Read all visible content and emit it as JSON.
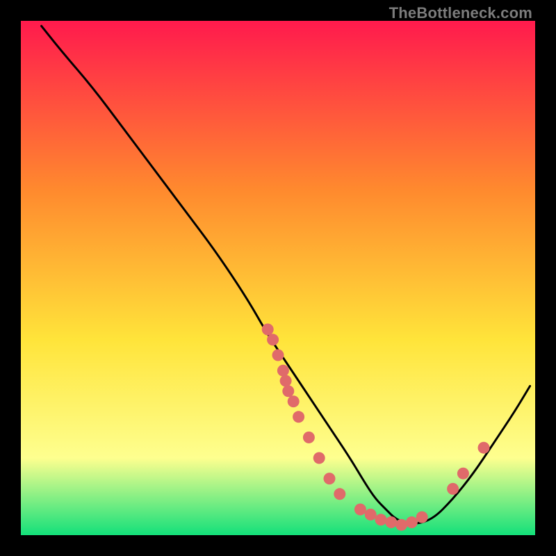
{
  "watermark": "TheBottleneck.com",
  "colors": {
    "gradient_top": "#ff1a4d",
    "gradient_mid1": "#ff8a2e",
    "gradient_mid2": "#ffe43a",
    "gradient_mid3": "#feff8f",
    "gradient_bottom": "#13e07a",
    "curve": "#000000",
    "dots": "#e06a6a",
    "frame_bg": "#000000"
  },
  "chart_data": {
    "type": "line",
    "title": "",
    "xlabel": "",
    "ylabel": "",
    "xlim": [
      0,
      100
    ],
    "ylim": [
      0,
      100
    ],
    "series": [
      {
        "name": "bottleneck-curve",
        "x": [
          4,
          8,
          14,
          20,
          26,
          32,
          38,
          44,
          48,
          52,
          56,
          60,
          64,
          67,
          69,
          71,
          73,
          76,
          80,
          84,
          88,
          92,
          96,
          99
        ],
        "y": [
          99,
          94,
          87,
          79,
          71,
          63,
          55,
          46,
          39,
          33,
          27,
          21,
          15,
          10,
          7,
          5,
          3,
          2,
          3,
          7,
          12,
          18,
          24,
          29
        ]
      }
    ],
    "scatter": {
      "name": "data-points",
      "points": [
        {
          "x": 48,
          "y": 40
        },
        {
          "x": 49,
          "y": 38
        },
        {
          "x": 50,
          "y": 35
        },
        {
          "x": 51,
          "y": 32
        },
        {
          "x": 51.5,
          "y": 30
        },
        {
          "x": 52,
          "y": 28
        },
        {
          "x": 53,
          "y": 26
        },
        {
          "x": 54,
          "y": 23
        },
        {
          "x": 56,
          "y": 19
        },
        {
          "x": 58,
          "y": 15
        },
        {
          "x": 60,
          "y": 11
        },
        {
          "x": 62,
          "y": 8
        },
        {
          "x": 66,
          "y": 5
        },
        {
          "x": 68,
          "y": 4
        },
        {
          "x": 70,
          "y": 3
        },
        {
          "x": 72,
          "y": 2.5
        },
        {
          "x": 74,
          "y": 2
        },
        {
          "x": 76,
          "y": 2.5
        },
        {
          "x": 78,
          "y": 3.5
        },
        {
          "x": 84,
          "y": 9
        },
        {
          "x": 86,
          "y": 12
        },
        {
          "x": 90,
          "y": 17
        }
      ]
    }
  }
}
